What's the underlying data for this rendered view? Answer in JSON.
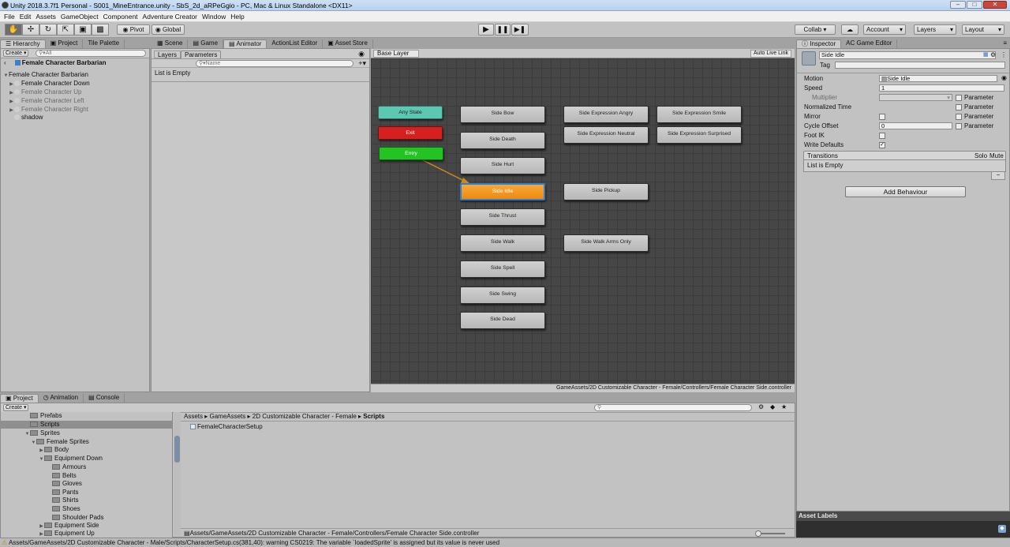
{
  "window": {
    "title": "Unity 2018.3.7f1 Personal - S001_MineEntrance.unity - SbS_2d_aRPeGgio - PC, Mac & Linux Standalone <DX11>"
  },
  "menu": [
    "File",
    "Edit",
    "Assets",
    "GameObject",
    "Component",
    "Adventure Creator",
    "Window",
    "Help"
  ],
  "toolbar": {
    "pivot": "Pivot",
    "global": "Global",
    "collab": "Collab ▾",
    "account": "Account",
    "layers": "Layers",
    "layout": "Layout"
  },
  "hierarchy": {
    "tabs": [
      "Hierarchy",
      "Project",
      "Tile Palette"
    ],
    "create": "Create ▾",
    "search_placeholder": "All",
    "header": "Female Character Barbarian",
    "root": "Female Character Barbarian",
    "items": [
      "Female Character Down",
      "Female Character Up",
      "Female Character Left",
      "Female Character Right",
      "shadow"
    ]
  },
  "center_tabs": [
    "Scene",
    "Game",
    "Animator",
    "ActionList Editor",
    "Asset Store"
  ],
  "animator": {
    "left_tabs": [
      "Layers",
      "Parameters"
    ],
    "search_placeholder": "Name",
    "list_empty": "List is Empty",
    "breadcrumb": "Base Layer",
    "auto_live_link": "Auto Live Link",
    "controller_path": "GameAssets/2D Customizable Character - Female/Controllers/Female Character Side.controller",
    "special_nodes": {
      "any_state": "Any State",
      "exit": "Exit",
      "entry": "Entry"
    },
    "states_col1": [
      "Side Bow",
      "Side Death",
      "Side Hurt",
      "Side Idle",
      "Side Thrust",
      "Side Walk",
      "Side Spell",
      "Side Swing",
      "Side Dead"
    ],
    "states_col2": [
      "Side Expression Angry",
      "Side Expression Neutral",
      "Side Pickup",
      "Side Walk Arms Only"
    ],
    "states_col3": [
      "Side Expression Smile",
      "Side Expression Surprised"
    ],
    "selected_state": "Side Idle",
    "colors": {
      "graph_bg": "#464646",
      "any_state": "#5dc8b1",
      "exit": "#d62020",
      "entry": "#22c322",
      "default_state": "#f39a1c",
      "state": "#bdbdbd",
      "transition": "#c9891c"
    }
  },
  "inspector": {
    "tabs": [
      "Inspector",
      "AC Game Editor"
    ],
    "object_name": "Side Idle",
    "tag_label": "Tag",
    "props": [
      {
        "label": "Motion",
        "value": "Side Idle"
      },
      {
        "label": "Speed",
        "value": "1"
      },
      {
        "label": "Multiplier",
        "value": ""
      },
      {
        "label": "Normalized Time",
        "value": ""
      },
      {
        "label": "Mirror",
        "value": ""
      },
      {
        "label": "Cycle Offset",
        "value": "0"
      },
      {
        "label": "Foot IK",
        "value": ""
      },
      {
        "label": "Write Defaults",
        "value": ""
      }
    ],
    "parameter_label": "Parameter",
    "transitions_header": "Transitions",
    "solo": "Solo",
    "mute": "Mute",
    "transitions_empty": "List is Empty",
    "minus": "−",
    "add_behaviour": "Add Behaviour",
    "asset_labels": "Asset Labels"
  },
  "bottom_tabs": [
    "Project",
    "Animation",
    "Console"
  ],
  "project": {
    "create": "Create ▾",
    "tree": [
      {
        "label": "Prefabs",
        "indent": 1
      },
      {
        "label": "Scripts",
        "indent": 1
      },
      {
        "label": "Sprites",
        "indent": 1
      },
      {
        "label": "Female Sprites",
        "indent": 2
      },
      {
        "label": "Body",
        "indent": 3
      },
      {
        "label": "Equipment Down",
        "indent": 3
      },
      {
        "label": "Armours",
        "indent": 4
      },
      {
        "label": "Belts",
        "indent": 4
      },
      {
        "label": "Gloves",
        "indent": 4
      },
      {
        "label": "Pants",
        "indent": 4
      },
      {
        "label": "Shirts",
        "indent": 4
      },
      {
        "label": "Shoes",
        "indent": 4
      },
      {
        "label": "Shoulder Pads",
        "indent": 4
      },
      {
        "label": "Equipment Side",
        "indent": 3
      },
      {
        "label": "Equipment Up",
        "indent": 3
      }
    ],
    "breadcrumb": [
      "Assets",
      "GameAssets",
      "2D Customizable Character - Female",
      "Scripts"
    ],
    "file": "FemaleCharacterSetup",
    "footer_path": "Assets/GameAssets/2D Customizable Character - Female/Controllers/Female Character Side.controller"
  },
  "status": "Assets/GameAssets/2D Customizable Character - Male/Scripts/CharacterSetup.cs(381,40): warning CS0219: The variable `loadedSprite' is assigned but its value is never used"
}
